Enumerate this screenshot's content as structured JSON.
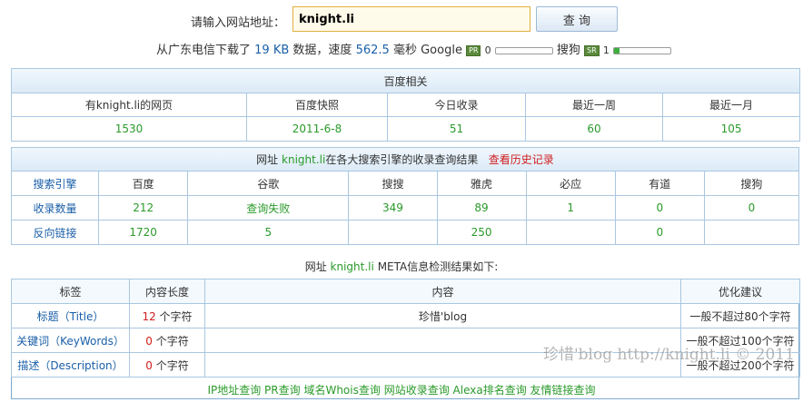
{
  "search": {
    "label": "请输入网站地址：",
    "value": "knight.li",
    "button": "查 询"
  },
  "status": {
    "prefix": "从广东电信下载了",
    "size": "19 KB",
    "mid": "数据，速度",
    "speed": "562.5",
    "unit": "毫秒",
    "google": "Google",
    "pr_badge": "PR",
    "pr_value": "0",
    "pr_level": 0,
    "sogou": "搜狗",
    "sr_badge": "SR",
    "sr_value": "1",
    "sr_level": 0.1
  },
  "baidu": {
    "title": "百度相关",
    "headers": [
      "有knight.li的网页",
      "百度快照",
      "今日收录",
      "最近一周",
      "最近一月"
    ],
    "values": [
      "1530",
      "2011-6-8",
      "51",
      "60",
      "105"
    ]
  },
  "engines": {
    "title_prefix": "网址",
    "domain": "knight.li",
    "title_suffix": "在各大搜索引擎的收录查询结果",
    "history_link": "查看历史记录",
    "headers": [
      "搜索引擎",
      "百度",
      "谷歌",
      "搜搜",
      "雅虎",
      "必应",
      "有道",
      "搜狗"
    ],
    "rows": [
      {
        "label": "收录数量",
        "cells": [
          "212",
          "查询失败",
          "349",
          "89",
          "1",
          "0",
          "0"
        ]
      },
      {
        "label": "反向链接",
        "cells": [
          "1720",
          "5",
          "",
          "250",
          "",
          "0",
          ""
        ]
      }
    ]
  },
  "meta": {
    "title_prefix": "网址",
    "domain": "knight.li",
    "title_suffix": "META信息检测结果如下:",
    "headers": [
      "标签",
      "内容长度",
      "内容",
      "优化建议"
    ],
    "rows": [
      {
        "label": "标题（Title）",
        "length": "12",
        "unit": "个字符",
        "content": "珍惜'blog",
        "advice": "一般不超过80个字符"
      },
      {
        "label": "关键词（KeyWords）",
        "length": "0",
        "unit": "个字符",
        "content": "",
        "advice": "一般不超过100个字符"
      },
      {
        "label": "描述（Description）",
        "length": "0",
        "unit": "个字符",
        "content": "",
        "advice": "一般不超过200个字符"
      }
    ]
  },
  "footer_links": [
    "IP地址查询",
    "PR查询",
    "域名Whois查询",
    "网站收录查询",
    "Alexa排名查询",
    "友情链接查询"
  ],
  "watermark": "珍惜'blog http://knight.li © 2011",
  "colors": {
    "border": "#a9c7e0",
    "green": "#2a9a2a",
    "blue": "#1a5fa8",
    "red": "#d02020"
  }
}
